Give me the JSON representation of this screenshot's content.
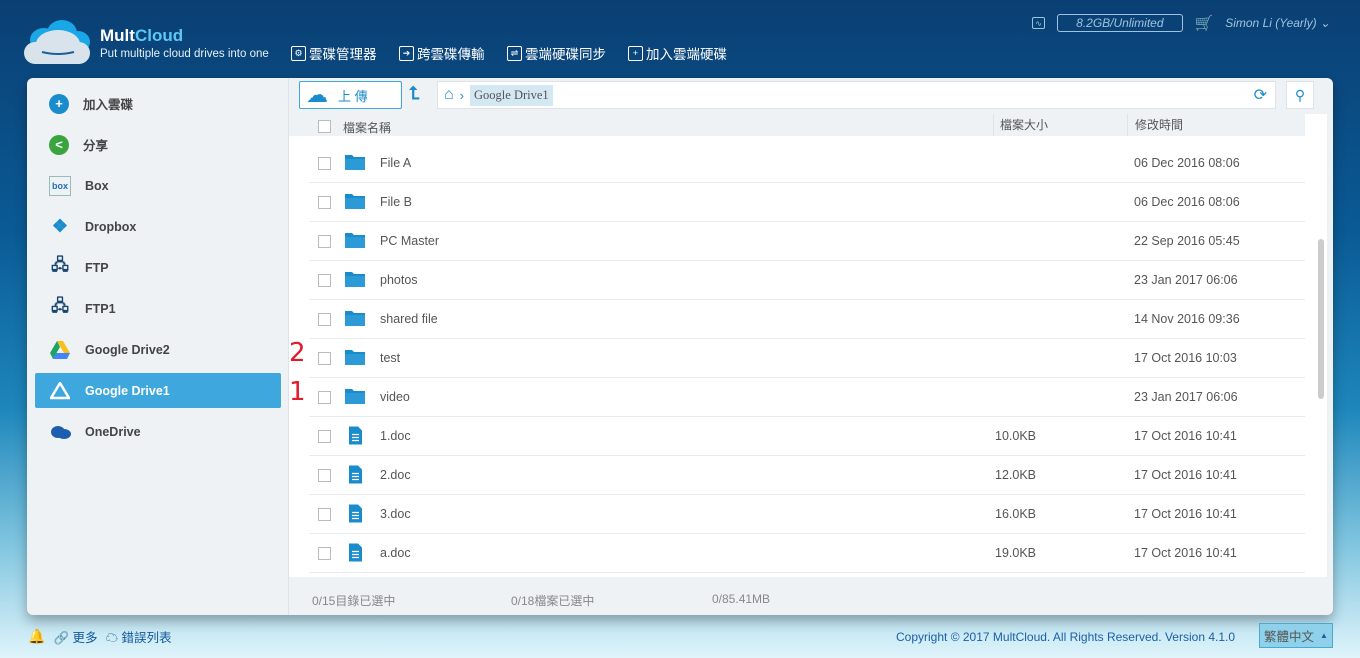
{
  "header": {
    "brand_a": "Mult",
    "brand_b": "Cloud",
    "slogan": "Put multiple cloud drives into one",
    "nav": [
      {
        "label": "雲碟管理器",
        "icon": "gear-icon"
      },
      {
        "label": "跨雲碟傳輸",
        "icon": "transfer-icon"
      },
      {
        "label": "雲端硬碟同步",
        "icon": "sync-icon"
      },
      {
        "label": "加入雲端硬碟",
        "icon": "add-icon"
      }
    ],
    "quota": "8.2GB/Unlimited",
    "user": "Simon Li (Yearly)"
  },
  "sidebar": {
    "items": [
      {
        "label": "加入雲碟"
      },
      {
        "label": "分享"
      },
      {
        "label": "Box"
      },
      {
        "label": "Dropbox"
      },
      {
        "label": "FTP"
      },
      {
        "label": "FTP1"
      },
      {
        "label": "Google Drive2"
      },
      {
        "label": "Google Drive1",
        "active": true
      },
      {
        "label": "OneDrive"
      }
    ]
  },
  "toolbar": {
    "upload": "上 傳",
    "breadcrumb": "Google Drive1"
  },
  "table": {
    "headers": {
      "name": "檔案名稱",
      "size": "檔案大小",
      "modified": "修改時間"
    },
    "rows": [
      {
        "name": "File A",
        "type": "folder",
        "size": "",
        "modified": "06 Dec 2016 08:06"
      },
      {
        "name": "File B",
        "type": "folder",
        "size": "",
        "modified": "06 Dec 2016 08:06"
      },
      {
        "name": "PC Master",
        "type": "folder",
        "size": "",
        "modified": "22 Sep 2016 05:45"
      },
      {
        "name": "photos",
        "type": "folder",
        "size": "",
        "modified": "23 Jan 2017 06:06"
      },
      {
        "name": "shared file",
        "type": "folder",
        "size": "",
        "modified": "14 Nov 2016 09:36"
      },
      {
        "name": "test",
        "type": "folder",
        "size": "",
        "modified": "17 Oct 2016 10:03"
      },
      {
        "name": "video",
        "type": "folder",
        "size": "",
        "modified": "23 Jan 2017 06:06"
      },
      {
        "name": "1.doc",
        "type": "doc",
        "size": "10.0KB",
        "modified": "17 Oct 2016 10:41"
      },
      {
        "name": "2.doc",
        "type": "doc",
        "size": "12.0KB",
        "modified": "17 Oct 2016 10:41"
      },
      {
        "name": "3.doc",
        "type": "doc",
        "size": "16.0KB",
        "modified": "17 Oct 2016 10:41"
      },
      {
        "name": "a.doc",
        "type": "doc",
        "size": "19.0KB",
        "modified": "17 Oct 2016 10:41"
      }
    ]
  },
  "annotations": [
    "2",
    "1"
  ],
  "status": {
    "dirs": "0/15目錄已選中",
    "files": "0/18檔案已選中",
    "size": "0/85.41MB"
  },
  "footer": {
    "more": "更多",
    "errors": "錯誤列表",
    "copyright": "Copyright © 2017 MultCloud. All Rights Reserved. Version 4.1.0",
    "language": "繁體中文"
  }
}
